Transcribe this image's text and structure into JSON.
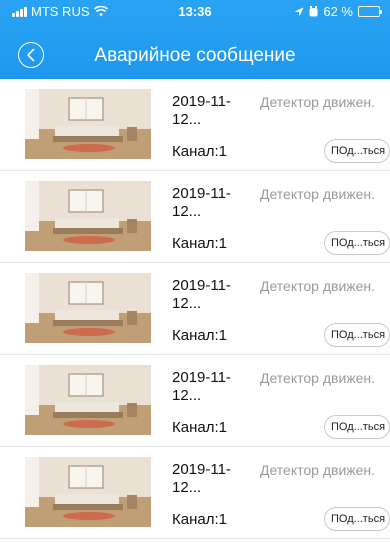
{
  "status_bar": {
    "carrier": "MTS RUS",
    "time": "13:36",
    "battery": "62 %",
    "battery_level": 0.62
  },
  "header": {
    "title": "Аварийное сообщение",
    "back_icon": "chevron-left-icon",
    "color": "#1e98ee"
  },
  "alarms": [
    {
      "date": "2019-11-\n12...",
      "event": "Детектор движен.",
      "channel": "Канал:1",
      "action_label": "ПОд...ться"
    },
    {
      "date": "2019-11-\n12...",
      "event": "Детектор движен.",
      "channel": "Канал:1",
      "action_label": "ПОд...ться"
    },
    {
      "date": "2019-11-\n12...",
      "event": "Детектор движен.",
      "channel": "Канал:1",
      "action_label": "ПОд...ться"
    },
    {
      "date": "2019-11-\n12...",
      "event": "Детектор движен.",
      "channel": "Канал:1",
      "action_label": "ПОд...ться"
    },
    {
      "date": "2019-11-\n12...",
      "event": "Детектор движен.",
      "channel": "Канал:1",
      "action_label": "ПОд...ться"
    }
  ]
}
